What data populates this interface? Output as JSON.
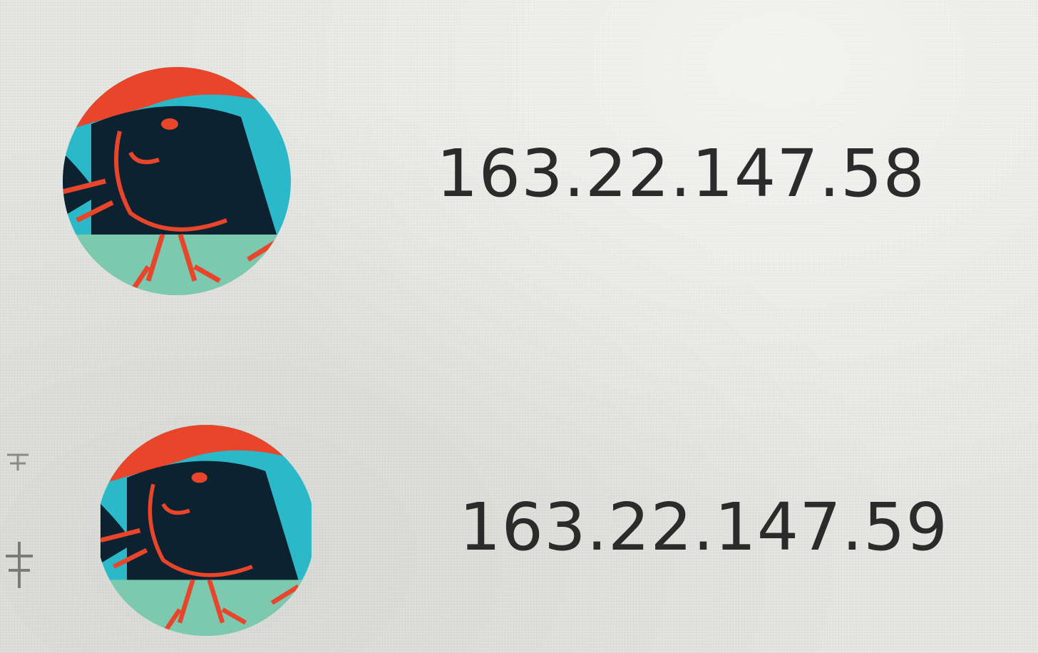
{
  "instances": [
    {
      "ip": "163.22.147.58",
      "avatar_icon": "bird-avatar-icon"
    },
    {
      "ip": "163.22.147.59",
      "avatar_icon": "bird-avatar-icon"
    }
  ],
  "colors": {
    "background": "#e6e6e2",
    "text": "#2b2b2b",
    "avatar_orange": "#e8452a",
    "avatar_teal": "#2bb8c8",
    "avatar_mint": "#7cc9b0",
    "avatar_dark": "#0c2230"
  }
}
